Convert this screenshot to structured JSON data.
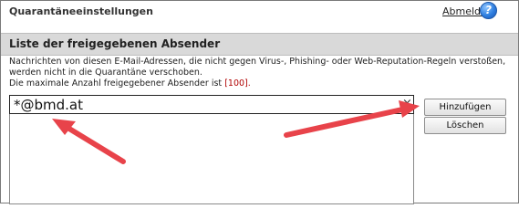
{
  "header": {
    "title": "Quarantäneeinstellungen",
    "logout_label": "Abmelden",
    "help_icon": "help-icon",
    "help_glyph": "?"
  },
  "section": {
    "title": "Liste der freigegebenen Absender",
    "description": "Nachrichten von diesen E-Mail-Adressen, die nicht gegen Virus-, Phishing- oder Web-Reputation-Regeln verstoßen, werden nicht in die Quarantäne verschoben.",
    "max_label": "Die maximale Anzahl freigegebener Absender ist",
    "max_value": "[100]."
  },
  "input": {
    "value": "*@bmd.at",
    "clear_glyph": "×"
  },
  "buttons": {
    "add_label": "Hinzufügen",
    "delete_label": "Löschen"
  },
  "colors": {
    "annotation_arrow": "#e8434a",
    "max_value": "#b00000",
    "section_header_bg": "#d9d9d9"
  }
}
